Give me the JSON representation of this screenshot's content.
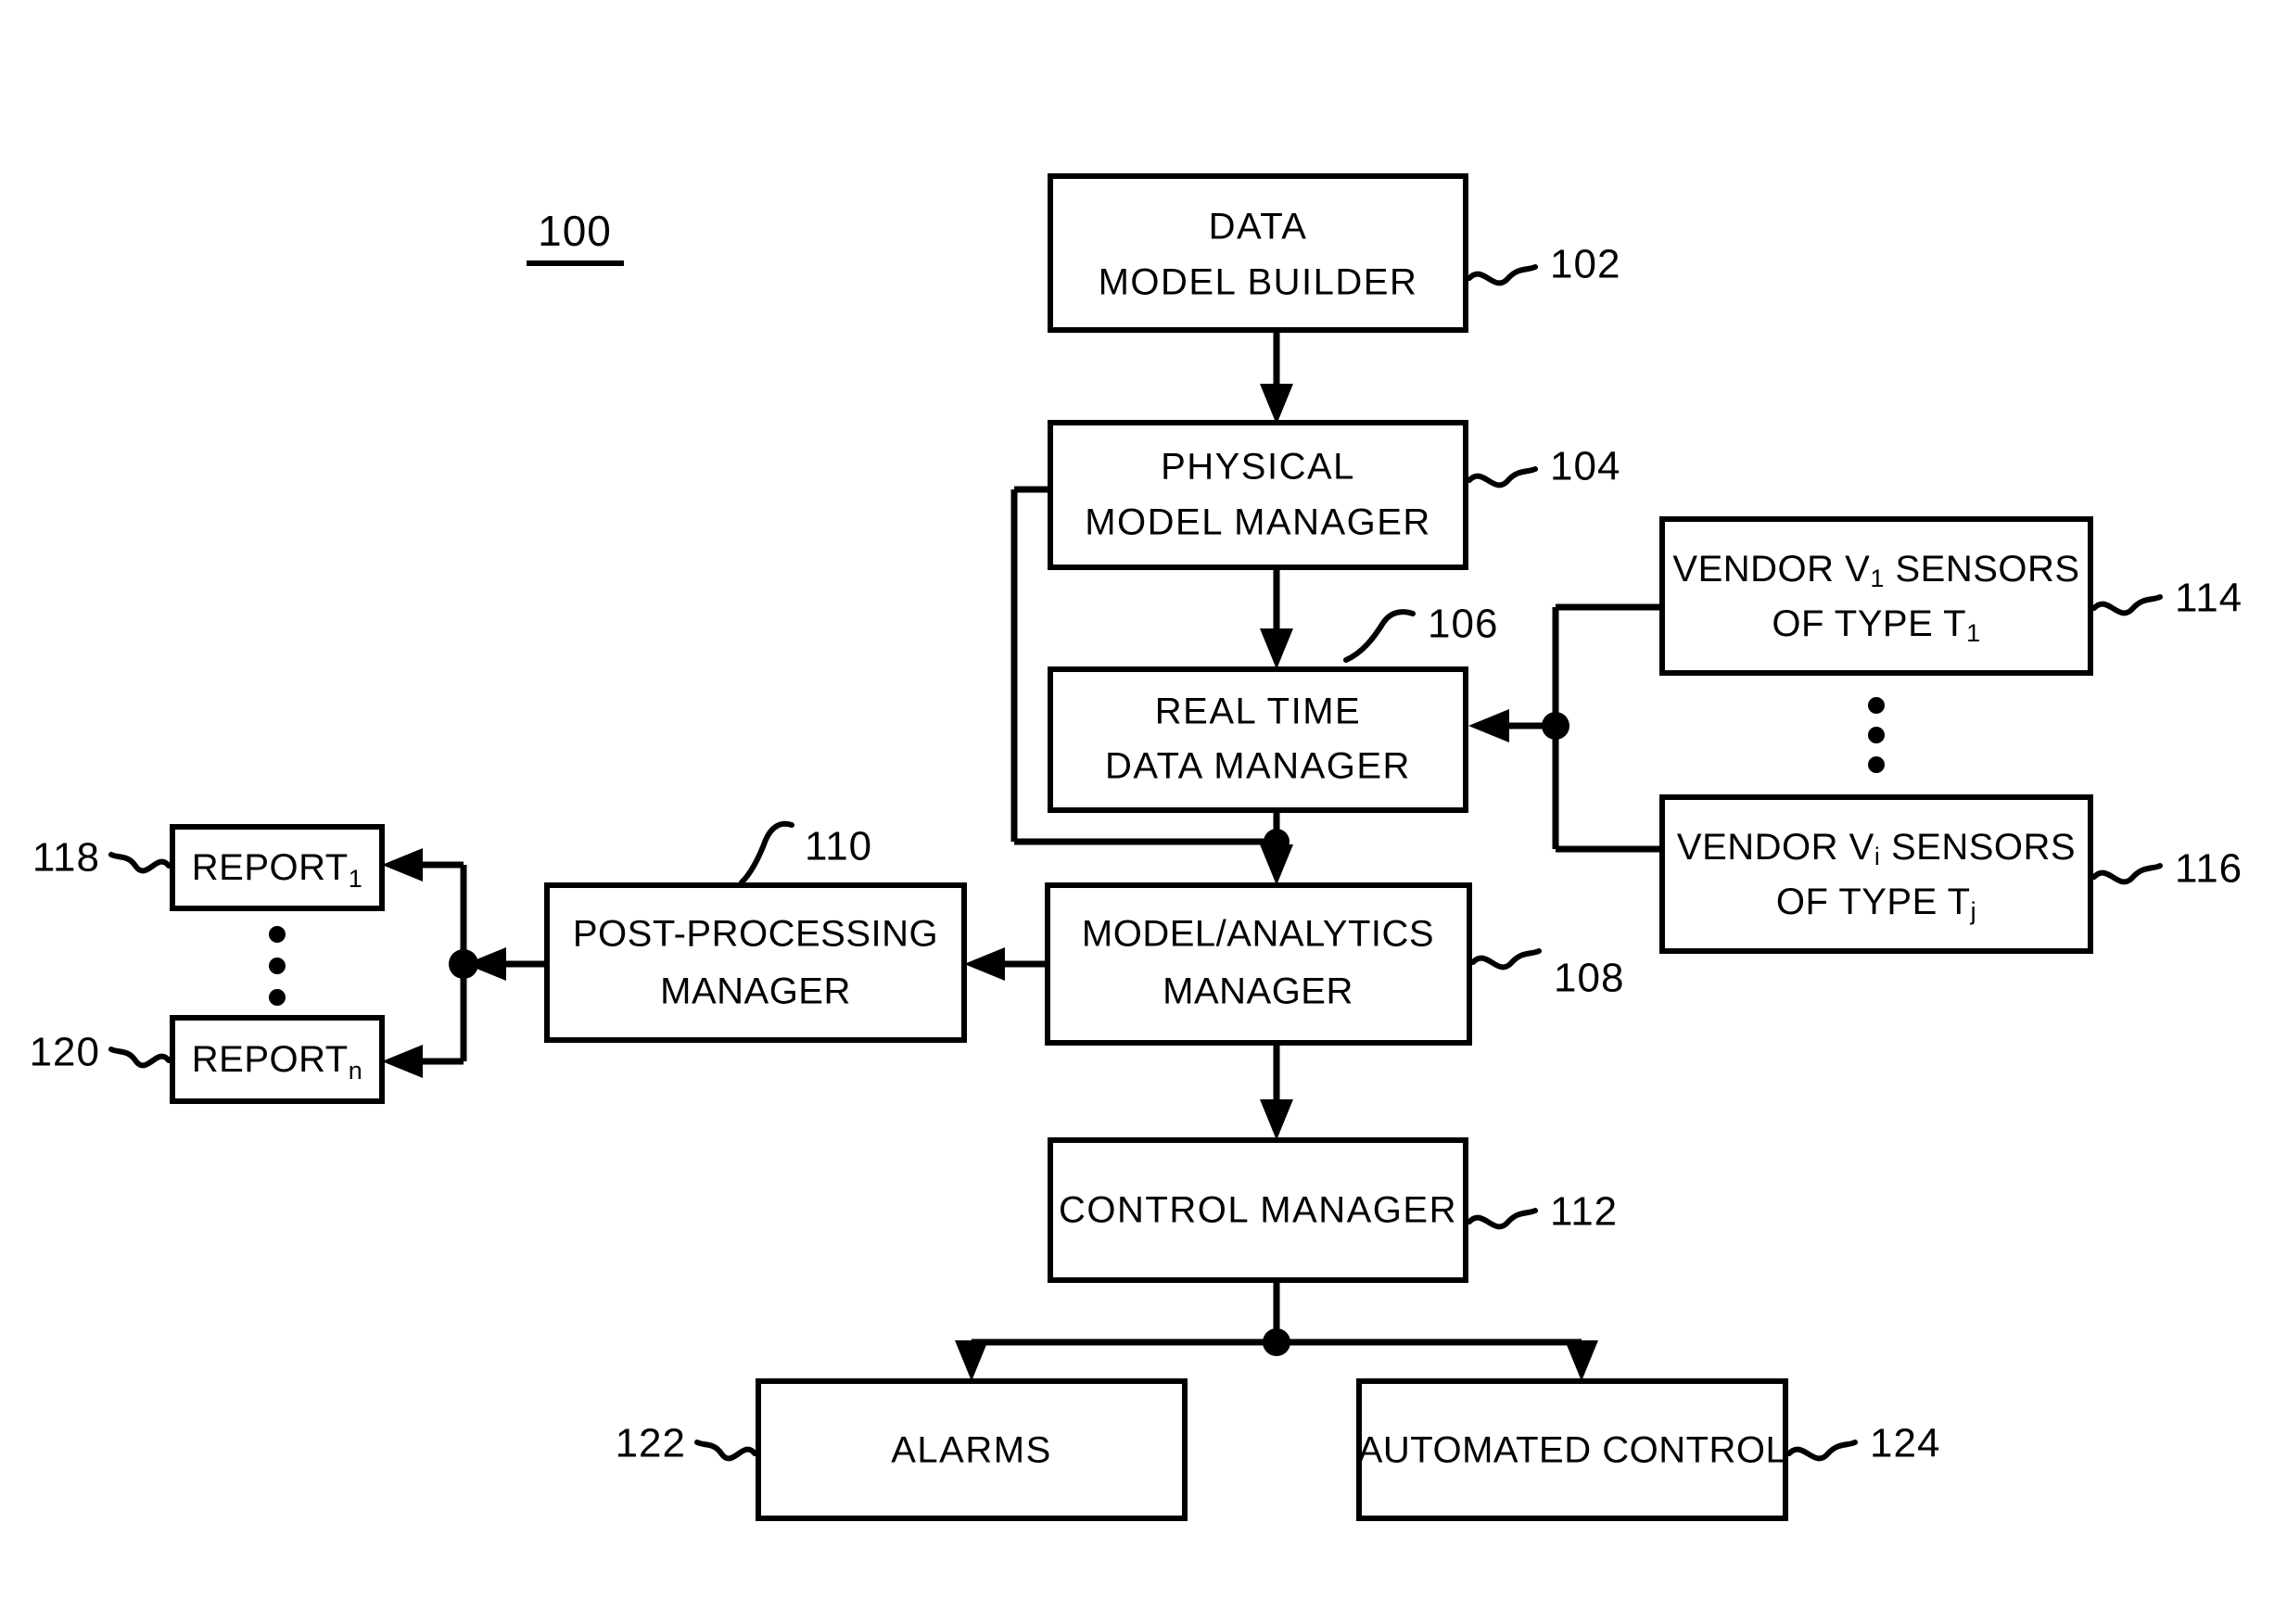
{
  "figure": {
    "number": "100",
    "underlined": true
  },
  "boxes": [
    {
      "id": "data-model-builder",
      "ref": "102",
      "lines": [
        "DATA",
        "MODEL BUILDER"
      ]
    },
    {
      "id": "physical-model-manager",
      "ref": "104",
      "lines": [
        "PHYSICAL",
        "MODEL MANAGER"
      ]
    },
    {
      "id": "real-time-data-manager",
      "ref": "106",
      "lines": [
        "REAL TIME",
        "DATA MANAGER"
      ]
    },
    {
      "id": "model-analytics-manager",
      "ref": "108",
      "lines": [
        "MODEL/ANALYTICS",
        "MANAGER"
      ]
    },
    {
      "id": "post-processing-manager",
      "ref": "110",
      "lines": [
        "POST-PROCESSING",
        "MANAGER"
      ]
    },
    {
      "id": "control-manager",
      "ref": "112",
      "lines": [
        "CONTROL MANAGER"
      ]
    },
    {
      "id": "vendor-sensors-1",
      "ref": "114",
      "lines": [
        "VENDOR V SENSORS",
        "OF TYPE T"
      ],
      "subscripts": [
        "1",
        "1"
      ]
    },
    {
      "id": "vendor-sensors-i",
      "ref": "116",
      "lines": [
        "VENDOR V SENSORS",
        "OF TYPE T"
      ],
      "subscripts": [
        "i",
        "j"
      ]
    },
    {
      "id": "report-1",
      "ref": "118",
      "lines": [
        "REPORT"
      ],
      "subscripts": [
        "1"
      ]
    },
    {
      "id": "report-n",
      "ref": "120",
      "lines": [
        "REPORT"
      ],
      "subscripts": [
        "n"
      ]
    },
    {
      "id": "alarms",
      "ref": "122",
      "lines": [
        "ALARMS"
      ]
    },
    {
      "id": "automated-control",
      "ref": "124",
      "lines": [
        "AUTOMATED CONTROL"
      ]
    }
  ],
  "labels": {
    "data_model_builder_line1": "DATA",
    "data_model_builder_line2": "MODEL BUILDER",
    "physical_model_manager_line1": "PHYSICAL",
    "physical_model_manager_line2": "MODEL MANAGER",
    "real_time_data_manager_line1": "REAL TIME",
    "real_time_data_manager_line2": "DATA MANAGER",
    "model_analytics_manager_line1": "MODEL/ANALYTICS",
    "model_analytics_manager_line2": "MANAGER",
    "post_processing_manager_line1": "POST-PROCESSING",
    "post_processing_manager_line2": "MANAGER",
    "control_manager": "CONTROL MANAGER",
    "vendor1_line1_pre": "VENDOR V",
    "vendor1_line1_sub": "1",
    "vendor1_line1_post": " SENSORS",
    "vendor1_line2_pre": "OF TYPE T",
    "vendor1_line2_sub": "1",
    "vendori_line1_pre": "VENDOR V",
    "vendori_line1_sub": "i",
    "vendori_line1_post": " SENSORS",
    "vendori_line2_pre": "OF TYPE T",
    "vendori_line2_sub": "j",
    "report1_text": "REPORT",
    "report1_sub": "1",
    "reportn_text": "REPORT",
    "reportn_sub": "n",
    "alarms": "ALARMS",
    "automated_control": "AUTOMATED CONTROL"
  },
  "refs": {
    "r102": "102",
    "r104": "104",
    "r106": "106",
    "r108": "108",
    "r110": "110",
    "r112": "112",
    "r114": "114",
    "r116": "116",
    "r118": "118",
    "r120": "120",
    "r122": "122",
    "r124": "124"
  },
  "colors": {
    "line": "#000000",
    "fill": "#ffffff",
    "background": "#ffffff"
  }
}
